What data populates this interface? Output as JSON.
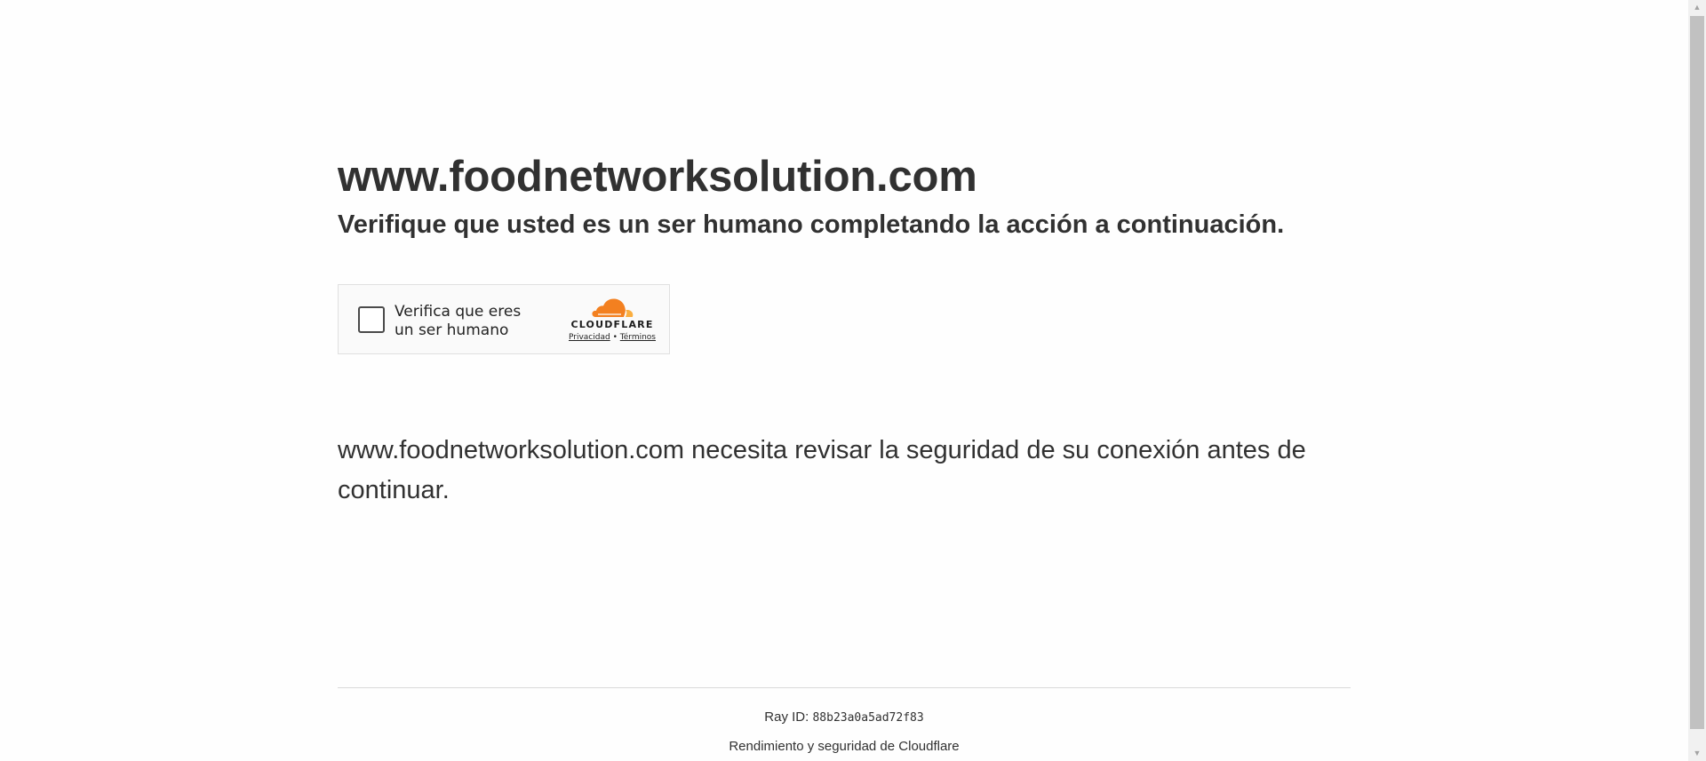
{
  "header": {
    "site_title": "www.foodnetworksolution.com",
    "subtitle": "Verifique que usted es un ser humano completando la acción a continuación."
  },
  "challenge": {
    "checkbox_label_line1": "Verifica que eres",
    "checkbox_label_line2": "un ser humano",
    "checked": false,
    "brand_text": "CLOUDFLARE",
    "privacy_link": "Privacidad",
    "separator": "•",
    "terms_link": "Términos"
  },
  "message": "www.foodnetworksolution.com necesita revisar la seguridad de su conexión antes de continuar.",
  "footer": {
    "ray_label": "Ray ID:",
    "ray_id": "88b23a0a5ad72f83",
    "performance_text": "Rendimiento y seguridad de Cloudflare"
  },
  "colors": {
    "text": "#313131",
    "cloudflare_orange": "#f38020",
    "cloudflare_light_orange": "#faae40",
    "widget_background": "#fafafa",
    "scrollbar_thumb": "#c1c1c1"
  },
  "icons": {
    "cloud": "cloudflare-cloud-icon",
    "scroll_up": "arrow-up-icon",
    "scroll_down": "arrow-down-icon"
  }
}
